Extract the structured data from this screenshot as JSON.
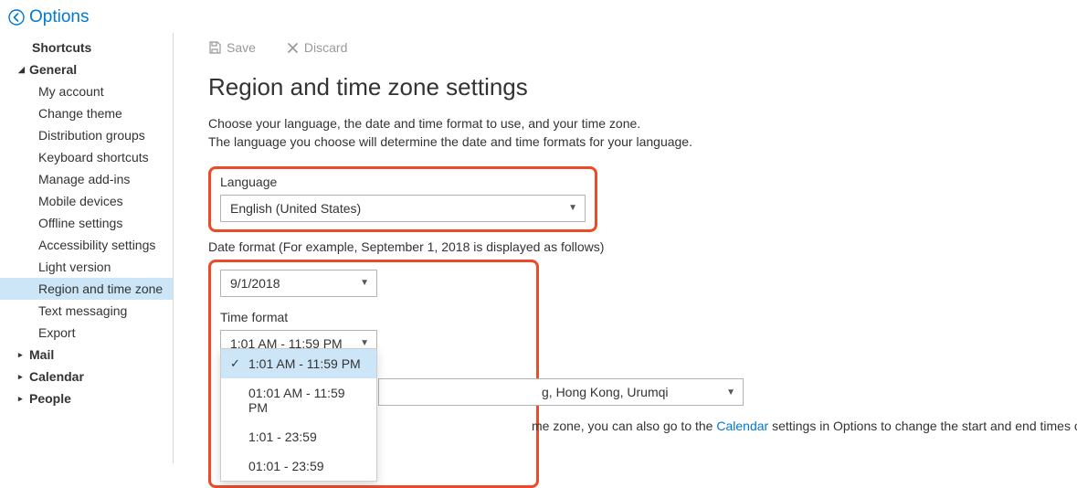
{
  "header": {
    "title": "Options"
  },
  "sidebar": {
    "shortcuts": "Shortcuts",
    "general": "General",
    "general_items": [
      "My account",
      "Change theme",
      "Distribution groups",
      "Keyboard shortcuts",
      "Manage add-ins",
      "Mobile devices",
      "Offline settings",
      "Accessibility settings",
      "Light version",
      "Region and time zone",
      "Text messaging",
      "Export"
    ],
    "mail": "Mail",
    "calendar": "Calendar",
    "people": "People"
  },
  "toolbar": {
    "save": "Save",
    "discard": "Discard"
  },
  "page": {
    "title": "Region and time zone settings",
    "desc1": "Choose your language, the date and time format to use, and your time zone.",
    "desc2": "The language you choose will determine the date and time formats for your language."
  },
  "language": {
    "label": "Language",
    "value": "English (United States)"
  },
  "date_format": {
    "label": "Date format (For example, September 1, 2018 is displayed as follows)",
    "value": "9/1/2018"
  },
  "time_format": {
    "label": "Time format",
    "value": "1:01 AM - 11:59 PM",
    "options": [
      "1:01 AM - 11:59 PM",
      "01:01 AM - 11:59 PM",
      "1:01 - 23:59",
      "01:01 - 23:59"
    ]
  },
  "timezone": {
    "value_suffix": "g, Hong Kong, Urumqi",
    "hint_prefix": "me zone, you can also go to the ",
    "hint_link": "Calendar",
    "hint_suffix": "  settings in Options to change the start and end times of your work week to match your time zone."
  }
}
